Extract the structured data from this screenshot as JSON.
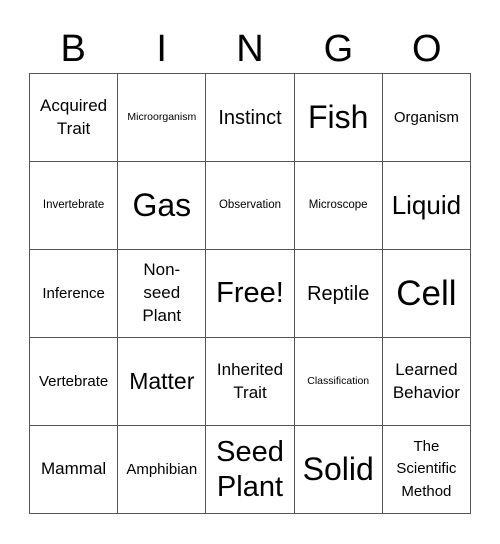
{
  "header": [
    "B",
    "I",
    "N",
    "G",
    "O"
  ],
  "cells": [
    [
      "Acquired Trait",
      "Microorganism",
      "Instinct",
      "Fish",
      "Organism"
    ],
    [
      "Invertebrate",
      "Gas",
      "Observation",
      "Microscope",
      "Liquid"
    ],
    [
      "Inference",
      "Non-seed Plant",
      "Free!",
      "Reptile",
      "Cell"
    ],
    [
      "Vertebrate",
      "Matter",
      "Inherited Trait",
      "Classification",
      "Learned Behavior"
    ],
    [
      "Mammal",
      "Amphibian",
      "Seed Plant",
      "Solid",
      "The Scientific Method"
    ]
  ]
}
